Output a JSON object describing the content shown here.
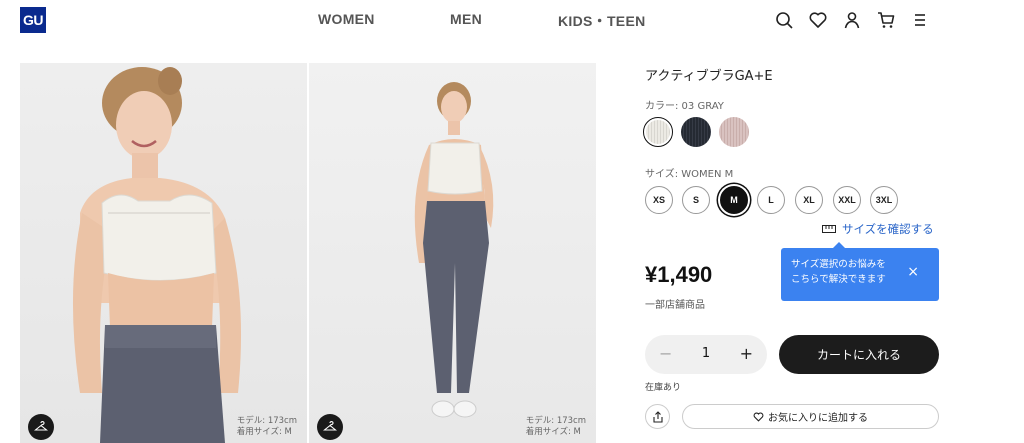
{
  "header": {
    "logo_text": "GU",
    "logo_color": "#0a2a8e",
    "nav": [
      "WOMEN",
      "MEN",
      "KIDS・TEEN"
    ],
    "icons": [
      "search-icon",
      "heart-icon",
      "user-icon",
      "cart-icon",
      "menu-icon"
    ]
  },
  "gallery": {
    "images": [
      {
        "model_height": "モデル: 173cm",
        "model_size": "着用サイズ: M"
      },
      {
        "model_height": "モデル: 173cm",
        "model_size": "着用サイズ: M"
      }
    ]
  },
  "product": {
    "title": "アクティブブラGA+E",
    "color_label": "カラー: 03 GRAY",
    "colors": [
      {
        "name": "GRAY",
        "hex": "#eceae4",
        "selected": true
      },
      {
        "name": "NAVY",
        "hex": "#252a33",
        "selected": false
      },
      {
        "name": "PINK",
        "hex": "#d9c2c0",
        "selected": false
      }
    ],
    "size_label": "サイズ: WOMEN M",
    "sizes": [
      "XS",
      "S",
      "M",
      "L",
      "XL",
      "XXL",
      "3XL"
    ],
    "selected_size": "M",
    "size_check_link": "サイズを確認する",
    "price": "¥1,490",
    "stock_note": "一部店舗商品",
    "tooltip": {
      "line1": "サイズ選択のお悩みを",
      "line2": "こちらで解決できます",
      "close": "×",
      "bg_color": "#3b82f0"
    },
    "quantity": {
      "minus": "−",
      "value": "1",
      "plus": "+"
    },
    "add_to_cart": "カートに入れる",
    "availability": "在庫あり",
    "favorite": "お気に入りに追加する"
  }
}
